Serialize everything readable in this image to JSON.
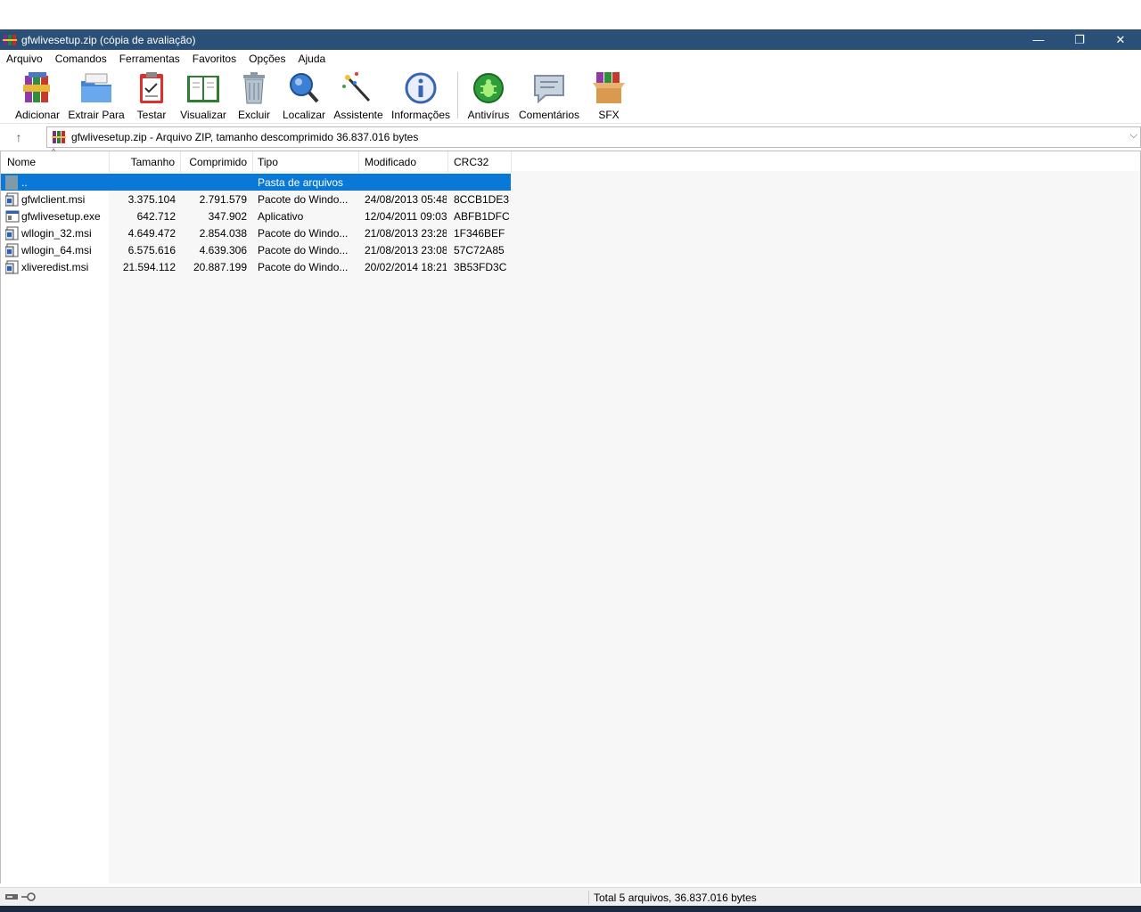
{
  "window": {
    "title": "gfwlivesetup.zip (cópia de avaliação)",
    "minimize_glyph": "—",
    "restore_glyph": "❐",
    "close_glyph": "✕"
  },
  "menu": [
    "Arquivo",
    "Comandos",
    "Ferramentas",
    "Favoritos",
    "Opções",
    "Ajuda"
  ],
  "toolbar": [
    {
      "label": "Adicionar",
      "icon": "add-archive-icon"
    },
    {
      "label": "Extrair Para",
      "icon": "extract-folder-icon"
    },
    {
      "label": "Testar",
      "icon": "test-clipboard-icon"
    },
    {
      "label": "Visualizar",
      "icon": "view-book-icon"
    },
    {
      "label": "Excluir",
      "icon": "trash-icon"
    },
    {
      "label": "Localizar",
      "icon": "magnifier-icon"
    },
    {
      "label": "Assistente",
      "icon": "magic-wand-icon"
    },
    {
      "label": "Informações",
      "icon": "info-icon"
    },
    {
      "label": "Antivírus",
      "icon": "antivirus-bug-icon"
    },
    {
      "label": "Comentários",
      "icon": "comment-icon"
    },
    {
      "label": "SFX",
      "icon": "sfx-box-icon"
    }
  ],
  "address": {
    "up_glyph": "↑",
    "text": "gfwlivesetup.zip - Arquivo ZIP, tamanho descomprimido 36.837.016 bytes",
    "dropdown_glyph": "⌵"
  },
  "columns": {
    "name": "Nome",
    "size": "Tamanho",
    "packed": "Comprimido",
    "type": "Tipo",
    "modified": "Modificado",
    "crc": "CRC32",
    "sort_glyph": "^"
  },
  "files": [
    {
      "name": "..",
      "size": "",
      "packed": "",
      "type": "Pasta de arquivos",
      "modified": "",
      "crc": "",
      "icon": "parent-folder-icon",
      "selected": true
    },
    {
      "name": "gfwlclient.msi",
      "size": "3.375.104",
      "packed": "2.791.579",
      "type": "Pacote do Windo...",
      "modified": "24/08/2013 05:48",
      "crc": "8CCB1DE3",
      "icon": "msi-package-icon",
      "selected": false
    },
    {
      "name": "gfwlivesetup.exe",
      "size": "642.712",
      "packed": "347.902",
      "type": "Aplicativo",
      "modified": "12/04/2011 09:03",
      "crc": "ABFB1DFC",
      "icon": "exe-application-icon",
      "selected": false
    },
    {
      "name": "wllogin_32.msi",
      "size": "4.649.472",
      "packed": "2.854.038",
      "type": "Pacote do Windo...",
      "modified": "21/08/2013 23:28",
      "crc": "1F346BEF",
      "icon": "msi-package-icon",
      "selected": false
    },
    {
      "name": "wllogin_64.msi",
      "size": "6.575.616",
      "packed": "4.639.306",
      "type": "Pacote do Windo...",
      "modified": "21/08/2013 23:08",
      "crc": "57C72A85",
      "icon": "msi-package-icon",
      "selected": false
    },
    {
      "name": "xliveredist.msi",
      "size": "21.594.112",
      "packed": "20.887.199",
      "type": "Pacote do Windo...",
      "modified": "20/02/2014 18:21",
      "crc": "3B53FD3C",
      "icon": "msi-package-icon",
      "selected": false
    }
  ],
  "status": {
    "text": "Total 5 arquivos, 36.837.016 bytes"
  },
  "colors": {
    "titlebar": "#2b5078",
    "selection": "#0a78d7"
  }
}
